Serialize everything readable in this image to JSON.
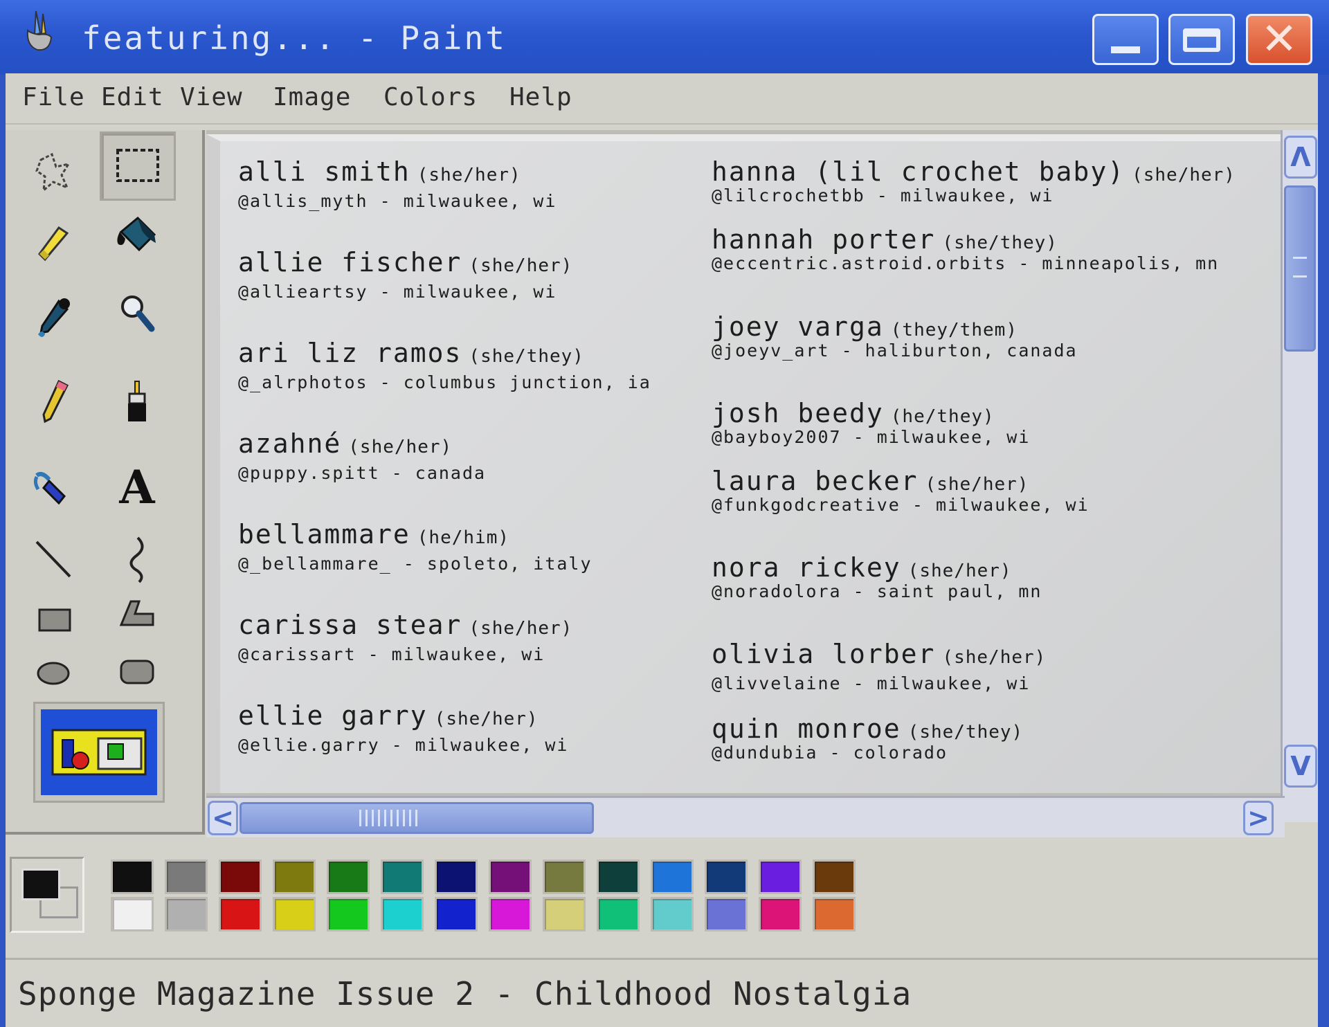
{
  "window": {
    "title": "featuring... - Paint",
    "minimize_icon": "minimize-icon",
    "maximize_icon": "maximize-icon",
    "close_icon": "close-icon",
    "close_glyph": "✕"
  },
  "menu": {
    "items": [
      "File",
      "Edit",
      "View",
      "Image",
      "Colors",
      "Help"
    ]
  },
  "tools": [
    {
      "name": "free-form-select-icon"
    },
    {
      "name": "rectangle-select-icon",
      "selected": true
    },
    {
      "name": "eraser-icon"
    },
    {
      "name": "fill-bucket-icon"
    },
    {
      "name": "color-picker-icon"
    },
    {
      "name": "magnifier-icon"
    },
    {
      "name": "pencil-icon"
    },
    {
      "name": "brush-icon"
    },
    {
      "name": "airbrush-icon"
    },
    {
      "name": "text-icon",
      "glyph": "A"
    },
    {
      "name": "line-icon"
    },
    {
      "name": "curve-icon"
    },
    {
      "name": "rectangle-icon"
    },
    {
      "name": "polygon-icon"
    },
    {
      "name": "ellipse-icon"
    },
    {
      "name": "rounded-rectangle-icon"
    }
  ],
  "contributors": {
    "left": [
      {
        "name": "alli smith",
        "pronouns": "(she/her)",
        "handle": "@allis_myth - milwaukee, wi"
      },
      {
        "name": "allie fischer",
        "pronouns": "(she/her)",
        "handle": "@allieartsy - milwaukee, wi"
      },
      {
        "name": "ari liz ramos",
        "pronouns": "(she/they)",
        "handle": "@_alrphotos - columbus junction, ia"
      },
      {
        "name": "azahné",
        "pronouns": "(she/her)",
        "handle": "@puppy.spitt - canada"
      },
      {
        "name": "bellammare",
        "pronouns": "(he/him)",
        "handle": "@_bellammare_ - spoleto, italy"
      },
      {
        "name": "carissa stear",
        "pronouns": "(she/her)",
        "handle": "@carissart - milwaukee, wi"
      },
      {
        "name": "ellie garry",
        "pronouns": "(she/her)",
        "handle": "@ellie.garry - milwaukee, wi"
      }
    ],
    "right": [
      {
        "name": "hanna (lil crochet baby)",
        "pronouns": "(she/her)",
        "handle": "@lilcrochetbb - milwaukee, wi"
      },
      {
        "name": "hannah porter",
        "pronouns": "(she/they)",
        "handle": "@eccentric.astroid.orbits - minneapolis, mn"
      },
      {
        "name": "joey varga",
        "pronouns": "(they/them)",
        "handle": "@joeyv_art - haliburton, canada"
      },
      {
        "name": "josh beedy",
        "pronouns": "(he/they)",
        "handle": "@bayboy2007 - milwaukee, wi"
      },
      {
        "name": "laura becker",
        "pronouns": "(she/her)",
        "handle": "@funkgodcreative - milwaukee, wi"
      },
      {
        "name": "nora rickey",
        "pronouns": "(she/her)",
        "handle": "@noradolora - saint paul, mn"
      },
      {
        "name": "olivia lorber",
        "pronouns": "(she/her)",
        "handle": "@livvelaine - milwaukee, wi"
      },
      {
        "name": "quin monroe",
        "pronouns": "(she/they)",
        "handle": "@dundubia - colorado"
      }
    ]
  },
  "scroll": {
    "up_glyph": "Λ",
    "down_glyph": "V",
    "left_glyph": "<",
    "right_glyph": ">"
  },
  "palette": {
    "foreground": "#111111",
    "background": "#d3d2cb",
    "colors_top": [
      "#101010",
      "#7a7a7a",
      "#7a0a0a",
      "#7f7a10",
      "#177a17",
      "#127a74",
      "#0b1272",
      "#741078",
      "#777a3e",
      "#0e3f3a",
      "#1f74da",
      "#123a78",
      "#6a1ee0",
      "#6b3a0c"
    ],
    "colors_bottom": [
      "#f0f0f0",
      "#b0b0b0",
      "#d81414",
      "#d8d018",
      "#14c81e",
      "#1cd0d0",
      "#1222cc",
      "#d818d8",
      "#d4cf78",
      "#10c078",
      "#62cccc",
      "#6a72d6",
      "#dc1478",
      "#dc6a30"
    ]
  },
  "status": {
    "text": "Sponge Magazine Issue 2 - Childhood Nostalgia"
  }
}
